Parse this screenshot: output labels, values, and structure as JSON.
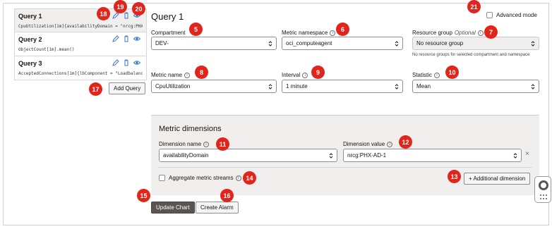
{
  "queries": [
    {
      "name": "Query 1",
      "expr": "CpuUtilization[1m]{availabilityDomain = \"nrcg:PHX…",
      "active": true
    },
    {
      "name": "Query 2",
      "expr": "ObjectCount[1m].mean()",
      "active": false
    },
    {
      "name": "Query 3",
      "expr": "AcceptedConnections[1m]{lbComponent = \"Loadbalanc…",
      "active": false
    }
  ],
  "add_query_label": "Add Query",
  "editor": {
    "title": "Query 1",
    "advanced_mode_label": "Advanced mode",
    "compartment": {
      "label": "Compartment",
      "value": "DEV-"
    },
    "metric_namespace": {
      "label": "Metric namespace",
      "value": "oci_computeagent"
    },
    "resource_group": {
      "label": "Resource group",
      "optional": "Optional",
      "value": "No resource group",
      "hint": "No resource groups for selected compartment and namespace"
    },
    "metric_name": {
      "label": "Metric name",
      "value": "CpuUtilization"
    },
    "interval": {
      "label": "Interval",
      "value": "1 minute"
    },
    "statistic": {
      "label": "Statistic",
      "value": "Mean"
    }
  },
  "dimensions": {
    "title": "Metric dimensions",
    "name_label": "Dimension name",
    "name_value": "availabilityDomain",
    "value_label": "Dimension value",
    "value_value": "nrcg:PHX-AD-1",
    "remove_symbol": "×",
    "aggregate_label": "Aggregate metric streams",
    "additional_label": "+ Additional dimension"
  },
  "actions": {
    "update_chart": "Update Chart",
    "create_alarm": "Create Alarm"
  },
  "badges": [
    "5",
    "6",
    "7",
    "8",
    "9",
    "10",
    "11",
    "12",
    "13",
    "14",
    "15",
    "16",
    "17",
    "18",
    "19",
    "20",
    "21"
  ],
  "info_glyph": "i",
  "colors": {
    "badge": "#e1251b",
    "primary_button": "#5a5550",
    "panel": "#f1efed",
    "eye_icon": "#3a74c8"
  }
}
